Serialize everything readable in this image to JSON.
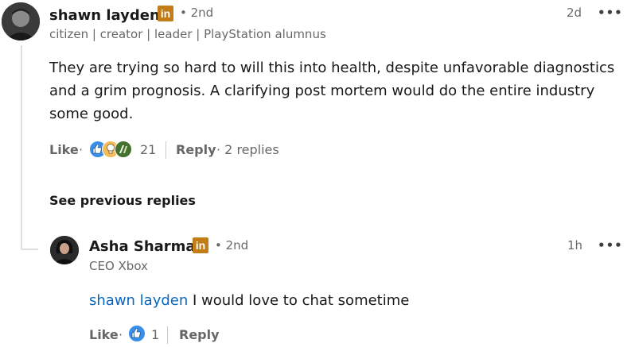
{
  "comment": {
    "author": "shawn layden",
    "badge": "in",
    "degree": "• 2nd",
    "headline": "citizen | creator | leader | PlayStation alumnus",
    "time": "2d",
    "more": "•••",
    "text": "They are trying so hard to will this into health, despite unfavorable diagnostics and a grim prognosis. A clarifying post mortem would do the entire industry some good.",
    "like_label": "Like",
    "dot": "·",
    "reactions": [
      "like-icon",
      "insightful-icon",
      "celebrate-icon"
    ],
    "reaction_count": "21",
    "reply_label": "Reply",
    "replies_label": "· 2 replies"
  },
  "see_previous": "See previous replies",
  "reply": {
    "author": "Asha Sharma",
    "badge": "in",
    "degree": "• 2nd",
    "headline": "CEO Xbox",
    "time": "1h",
    "more": "•••",
    "mention": "shawn layden",
    "text": " I would love to chat sometime",
    "like_label": "Like",
    "dot": "·",
    "reactions": [
      "like-icon"
    ],
    "reaction_count": "1",
    "reply_label": "Reply"
  },
  "colors": {
    "linkedin_badge": "#c37d16",
    "mention": "#0a66c2",
    "like_blue": "#378fe9",
    "insightful_yellow": "#f5bb5c",
    "celebrate_green": "#44712e"
  }
}
